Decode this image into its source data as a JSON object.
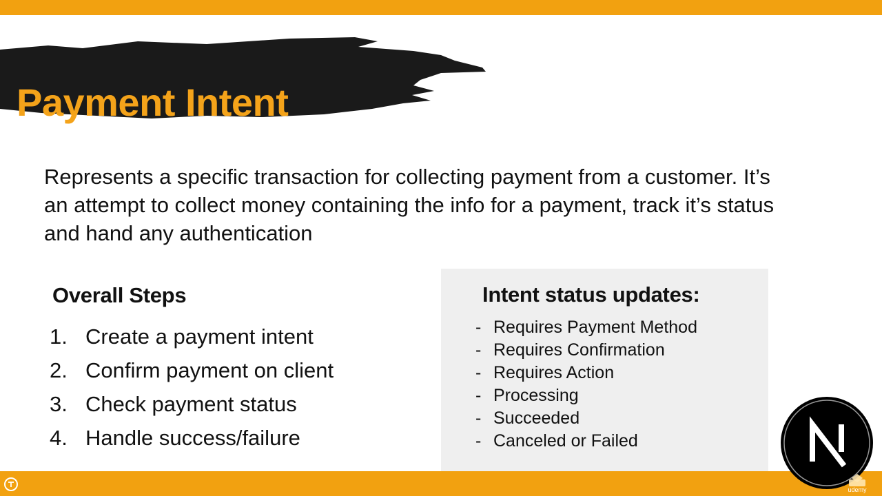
{
  "slide": {
    "title": "Payment Intent",
    "description": "Represents a specific transaction for collecting payment from a customer. It’s an attempt to collect money containing the info for a payment, track it’s status and hand any authentication",
    "steps_heading": "Overall Steps",
    "steps": [
      {
        "num": "1.",
        "label": "Create a payment intent"
      },
      {
        "num": "2.",
        "label": "Confirm payment on client"
      },
      {
        "num": "3.",
        "label": "Check payment status"
      },
      {
        "num": "4.",
        "label": "Handle success/failure"
      }
    ],
    "status_heading": "Intent status updates:",
    "statuses": [
      "Requires Payment Method",
      "Requires Confirmation",
      "Requires Action",
      "Processing",
      "Succeeded",
      "Canceled or Failed"
    ],
    "status_bullet": "-"
  },
  "branding": {
    "watermark": "udemy",
    "logo_icon": "nextjs-logo-icon",
    "instructor_icon": "instructor-badge-icon"
  },
  "colors": {
    "accent": "#f2a110",
    "title": "#f4a31a",
    "brush": "#1a1a1a",
    "panel": "#efefef"
  }
}
